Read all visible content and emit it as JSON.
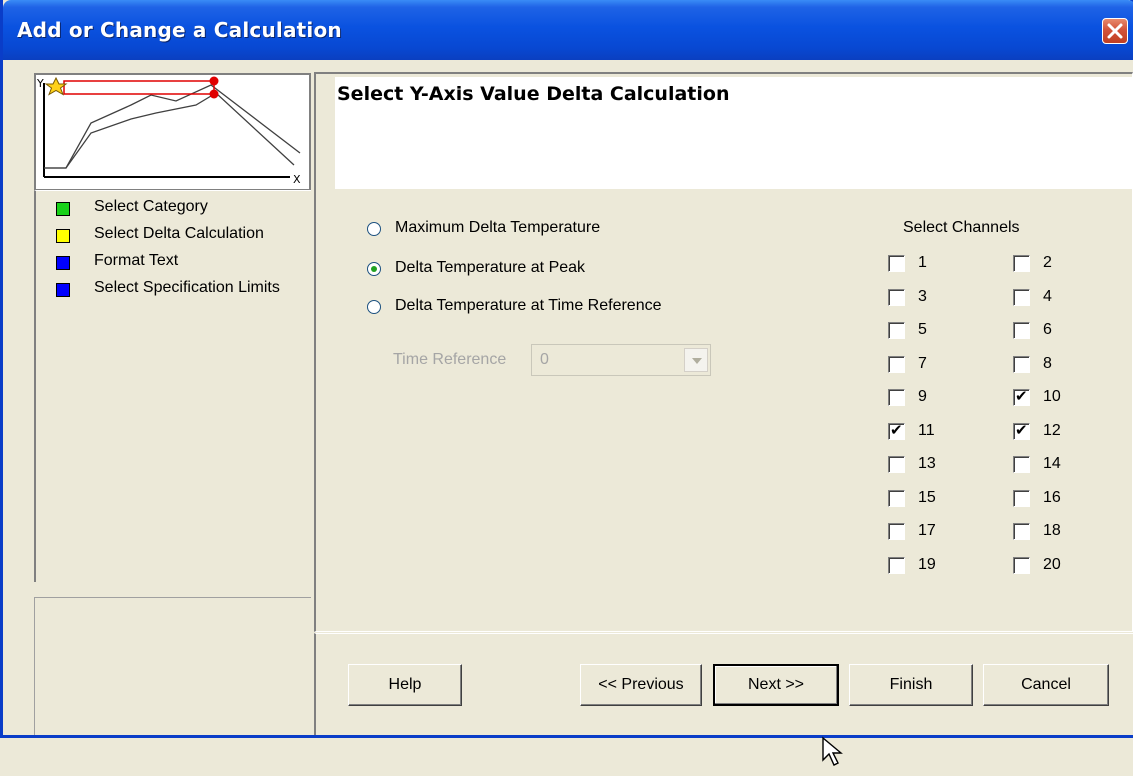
{
  "window": {
    "title": "Add or Change a Calculation"
  },
  "steps": [
    {
      "label": "Select Category",
      "color": "#19d119"
    },
    {
      "label": "Select Delta Calculation",
      "color": "#ffff00"
    },
    {
      "label": "Format Text",
      "color": "#0000ff"
    },
    {
      "label": "Select Specification Limits",
      "color": "#0000ff"
    }
  ],
  "preview": {
    "y_label": "Y",
    "x_label": "X"
  },
  "header": {
    "title": "Select Y-Axis Value Delta Calculation"
  },
  "options": [
    {
      "label": "Maximum Delta Temperature",
      "checked": false
    },
    {
      "label": "Delta Temperature at Peak",
      "checked": true
    },
    {
      "label": "Delta Temperature at Time Reference",
      "checked": false
    }
  ],
  "time_reference": {
    "label": "Time Reference",
    "value": "0",
    "enabled": false
  },
  "channels": {
    "title": "Select Channels",
    "items": [
      {
        "label": "1",
        "checked": false
      },
      {
        "label": "2",
        "checked": false
      },
      {
        "label": "3",
        "checked": false
      },
      {
        "label": "4",
        "checked": false
      },
      {
        "label": "5",
        "checked": false
      },
      {
        "label": "6",
        "checked": false
      },
      {
        "label": "7",
        "checked": false
      },
      {
        "label": "8",
        "checked": false
      },
      {
        "label": "9",
        "checked": false
      },
      {
        "label": "10",
        "checked": true
      },
      {
        "label": "11",
        "checked": true
      },
      {
        "label": "12",
        "checked": true
      },
      {
        "label": "13",
        "checked": false
      },
      {
        "label": "14",
        "checked": false
      },
      {
        "label": "15",
        "checked": false
      },
      {
        "label": "16",
        "checked": false
      },
      {
        "label": "17",
        "checked": false
      },
      {
        "label": "18",
        "checked": false
      },
      {
        "label": "19",
        "checked": false
      },
      {
        "label": "20",
        "checked": false
      }
    ]
  },
  "buttons": {
    "help": "Help",
    "previous": "<< Previous",
    "next": "Next >>",
    "finish": "Finish",
    "cancel": "Cancel"
  }
}
